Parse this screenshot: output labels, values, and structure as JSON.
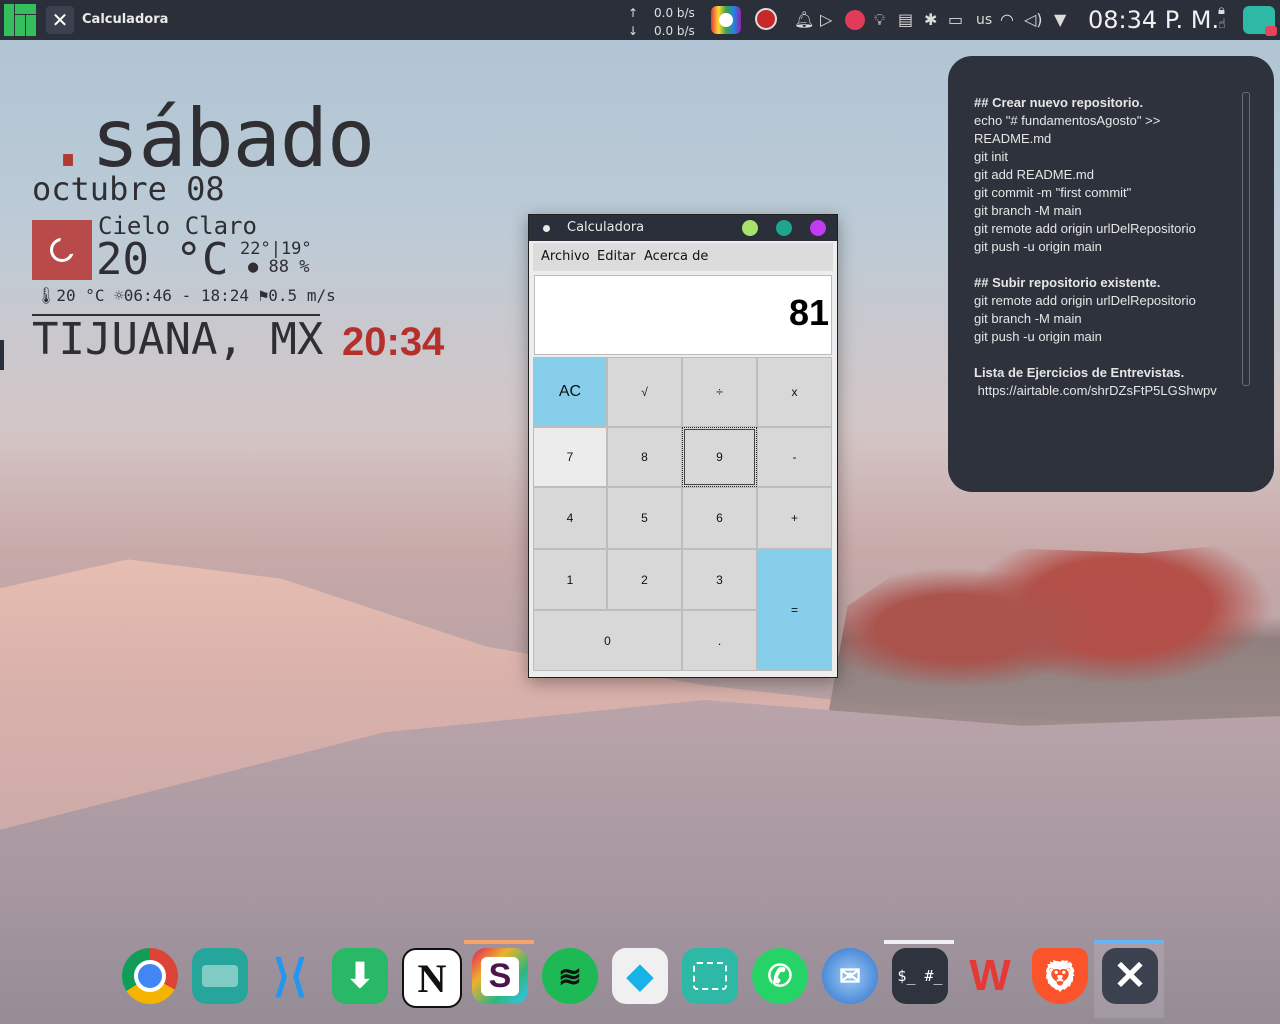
{
  "panel": {
    "active_task": "Calculadora",
    "net_up": "0.0 b/s",
    "net_down": "0.0 b/s",
    "up_arrow": "↑",
    "down_arrow": "↓",
    "keyboard_layout": "us",
    "clock": "08:34 P. M."
  },
  "widget": {
    "dot": ".",
    "day": "sábado",
    "date": "octubre 08",
    "condition": "Cielo Claro",
    "temperature": "20 °C",
    "high_low": "22°|19°",
    "humidity": "88 %",
    "feels": "20 °C",
    "sun": "06:46 - 18:24",
    "wind": "0.5 m/s",
    "city": "TIJUANA, MX",
    "time": "20:34"
  },
  "notes": {
    "lines": [
      {
        "text": "## Crear nuevo repositorio.",
        "bold": true
      },
      {
        "text": "echo \"# fundamentosAgosto\" >>",
        "bold": false
      },
      {
        "text": "README.md",
        "bold": false
      },
      {
        "text": "git init",
        "bold": false
      },
      {
        "text": "git add README.md",
        "bold": false
      },
      {
        "text": "git commit -m \"first commit\"",
        "bold": false
      },
      {
        "text": "git branch -M main",
        "bold": false
      },
      {
        "text": "git remote add origin urlDelRepositorio",
        "bold": false
      },
      {
        "text": "git push -u origin main",
        "bold": false
      },
      {
        "text": "",
        "bold": false
      },
      {
        "text": "## Subir repositorio existente.",
        "bold": true
      },
      {
        "text": "git remote add origin urlDelRepositorio",
        "bold": false
      },
      {
        "text": "git branch -M main",
        "bold": false
      },
      {
        "text": "git push -u origin main",
        "bold": false
      },
      {
        "text": "",
        "bold": false
      },
      {
        "text": "Lista de Ejercicios de Entrevistas.",
        "bold": true
      },
      {
        "text": " https://airtable.com/shrDZsFtP5LGShwpv",
        "bold": false
      }
    ]
  },
  "calculator": {
    "title": "Calculadora",
    "menu": [
      "Archivo",
      "Editar",
      "Acerca de"
    ],
    "display": "81",
    "keys": {
      "ac": "AC",
      "sqrt": "√",
      "div": "÷",
      "mul": "x",
      "k7": "7",
      "k8": "8",
      "k9": "9",
      "sub": "-",
      "k4": "4",
      "k5": "5",
      "k6": "6",
      "add": "+",
      "k1": "1",
      "k2": "2",
      "k3": "3",
      "eq": "=",
      "k0": "0",
      "dot": "."
    }
  },
  "dock": {
    "apps": [
      "chrome-icon",
      "files-icon",
      "vscode-icon",
      "downloader-icon",
      "notion-icon",
      "slack-icon",
      "spotify-icon",
      "kodi-icon",
      "screenshot-icon",
      "whatsapp-icon",
      "thunderbird-icon",
      "terminal-icon",
      "wps-office-icon",
      "brave-icon",
      "calculator-icon"
    ],
    "labels": {
      "notion": "N",
      "slack": "S",
      "terminal": "$_ #_",
      "wps": "W",
      "calc": "✕"
    }
  },
  "colors": {
    "panel_bg": "#2b2f3a",
    "accent_red": "#b5302a",
    "calc_blue": "#87ceeb",
    "notes_bg": "#2e323d",
    "manjaro_green": "#35bf5c"
  }
}
